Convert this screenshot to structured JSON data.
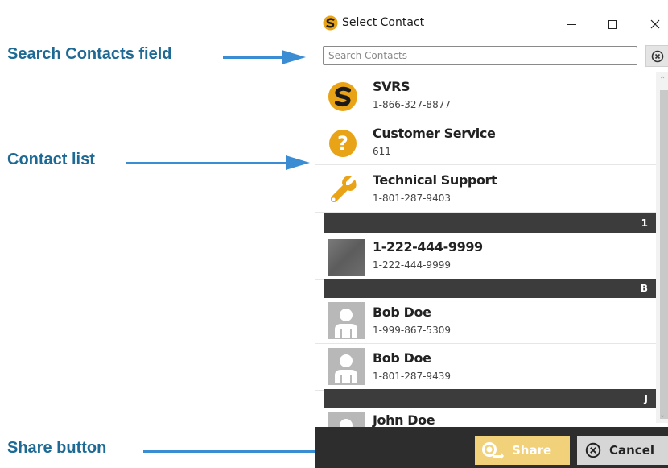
{
  "annotations": {
    "search_field": "Search Contacts field",
    "contact_list": "Contact list",
    "share_button": "Share button"
  },
  "window": {
    "title": "Select Contact"
  },
  "search": {
    "placeholder": "Search Contacts"
  },
  "contacts": [
    {
      "name": "SVRS",
      "number": "1-866-327-8877",
      "icon": "svrs-logo-icon"
    },
    {
      "name": "Customer Service",
      "number": "611",
      "icon": "question-icon"
    },
    {
      "name": "Technical Support",
      "number": "1-801-287-9403",
      "icon": "wrench-icon"
    }
  ],
  "sections": [
    {
      "letter": "1"
    },
    {
      "letter": "B"
    },
    {
      "letter": "J"
    }
  ],
  "section_contacts": [
    {
      "name": "1-222-444-9999",
      "number": "1-222-444-9999",
      "icon": "photo-avatar"
    },
    {
      "name": "Bob Doe",
      "number": "1-999-867-5309",
      "icon": "person-avatar-icon"
    },
    {
      "name": "Bob Doe",
      "number": "1-801-287-9439",
      "icon": "person-avatar-icon"
    },
    {
      "name": "John Doe",
      "number": "",
      "icon": "person-avatar-icon"
    }
  ],
  "footer": {
    "share_label": "Share",
    "cancel_label": "Cancel"
  },
  "colors": {
    "annotation": "#1e6a94",
    "arrow": "#3a8cd3",
    "brand_gold": "#e8a317",
    "share_button": "#f1d27a",
    "section_header": "#3c3c3c"
  }
}
